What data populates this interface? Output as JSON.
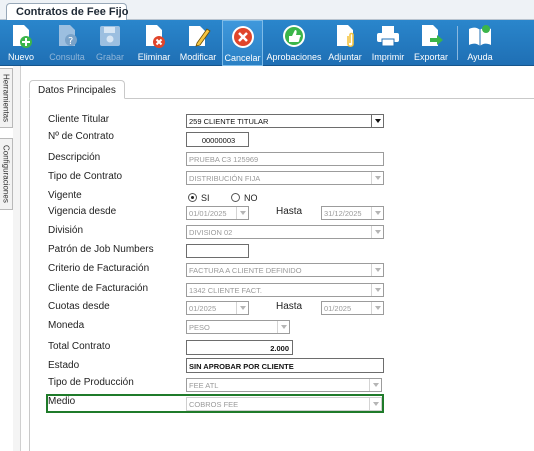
{
  "window": {
    "tab_title": "Contratos de Fee Fijo"
  },
  "toolbar": {
    "nuevo": "Nuevo",
    "consulta": "Consulta",
    "grabar": "Grabar",
    "eliminar": "Eliminar",
    "modificar": "Modificar",
    "cancelar": "Cancelar",
    "aprobaciones": "Aprobaciones",
    "adjuntar": "Adjuntar",
    "imprimir": "Imprimir",
    "exportar": "Exportar",
    "ayuda": "Ayuda"
  },
  "side_tabs": {
    "herramientas": "Herramientas",
    "configuraciones": "Configuraciones"
  },
  "panel": {
    "tab": "Datos Principales"
  },
  "form": {
    "cliente_titular": {
      "label": "Cliente Titular",
      "value": "259 CLIENTE TITULAR"
    },
    "nro_contrato": {
      "label": "Nº de Contrato",
      "value": "00000003"
    },
    "descripcion": {
      "label": "Descripción",
      "value": "PRUEBA C3 125969"
    },
    "tipo_contrato": {
      "label": "Tipo de Contrato",
      "value": "DISTRIBUCIÓN FIJA"
    },
    "vigente": {
      "label": "Vigente",
      "si": "SI",
      "no": "NO",
      "selected": "SI"
    },
    "vigencia": {
      "label": "Vigencia desde",
      "desde": "01/01/2025",
      "hasta_label": "Hasta",
      "hasta": "31/12/2025"
    },
    "division": {
      "label": "División",
      "value": "DIVISION 02"
    },
    "patron": {
      "label": "Patrón de Job Numbers",
      "value": ""
    },
    "criterio": {
      "label": "Criterio de Facturación",
      "value": "FACTURA A CLIENTE DEFINIDO"
    },
    "cliente_fact": {
      "label": "Cliente de Facturación",
      "value": "1342 CLIENTE FACT."
    },
    "cuotas": {
      "label": "Cuotas desde",
      "desde": "01/2025",
      "hasta_label": "Hasta",
      "hasta": "01/2025"
    },
    "moneda": {
      "label": "Moneda",
      "value": "PESO"
    },
    "total": {
      "label": "Total Contrato",
      "value": "2.000"
    },
    "estado": {
      "label": "Estado",
      "value": "SIN APROBAR POR CLIENTE"
    },
    "tipo_produccion": {
      "label": "Tipo de Producción",
      "value": "FEE ATL"
    },
    "medio": {
      "label": "Medio",
      "value": "COBROS FEE"
    }
  },
  "colors": {
    "toolbar": "#1f76bc",
    "highlight": "#1f7b2a",
    "cancel": "#e0452b"
  }
}
